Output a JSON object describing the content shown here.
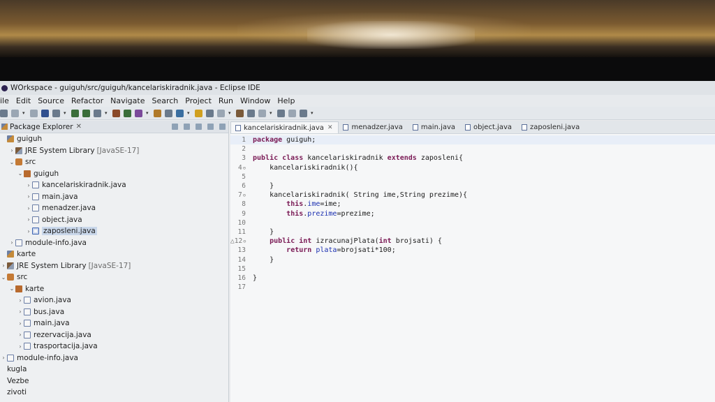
{
  "window": {
    "title": "WOrkspace - guiguh/src/guiguh/kancelariskiradnik.java - Eclipse IDE"
  },
  "menu": [
    "ile",
    "Edit",
    "Source",
    "Refactor",
    "Navigate",
    "Search",
    "Project",
    "Run",
    "Window",
    "Help"
  ],
  "explorer": {
    "title": "Package Explorer",
    "tree": [
      {
        "label": "guiguh",
        "icon": "project-icon",
        "depth": 0,
        "twisty": ""
      },
      {
        "label": "JRE System Library",
        "hint": "[JavaSE-17]",
        "icon": "library-icon",
        "depth": 1,
        "twisty": ">"
      },
      {
        "label": "src",
        "icon": "source-folder-icon",
        "depth": 1,
        "twisty": "v"
      },
      {
        "label": "guiguh",
        "icon": "package-icon",
        "depth": 2,
        "twisty": "v"
      },
      {
        "label": "kancelariskiradnik.java",
        "icon": "java-file-icon",
        "depth": 3,
        "twisty": ">"
      },
      {
        "label": "main.java",
        "icon": "java-file-icon",
        "depth": 3,
        "twisty": ">"
      },
      {
        "label": "menadzer.java",
        "icon": "java-file-icon",
        "depth": 3,
        "twisty": ">"
      },
      {
        "label": "object.java",
        "icon": "java-file-icon",
        "depth": 3,
        "twisty": ">"
      },
      {
        "label": "zaposleni.java",
        "icon": "java-file-icon",
        "depth": 3,
        "twisty": ">",
        "selected": true
      },
      {
        "label": "module-info.java",
        "icon": "java-file-icon",
        "depth": 1,
        "twisty": ">"
      },
      {
        "label": "karte",
        "icon": "project-icon",
        "depth": 0,
        "twisty": ""
      },
      {
        "label": "JRE System Library",
        "hint": "[JavaSE-17]",
        "icon": "library-icon",
        "depth": 0,
        "twisty": ">"
      },
      {
        "label": "src",
        "icon": "source-folder-icon",
        "depth": 0,
        "twisty": "v"
      },
      {
        "label": "karte",
        "icon": "package-icon",
        "depth": 1,
        "twisty": "v"
      },
      {
        "label": "avion.java",
        "icon": "java-file-icon",
        "depth": 2,
        "twisty": ">"
      },
      {
        "label": "bus.java",
        "icon": "java-file-icon",
        "depth": 2,
        "twisty": ">"
      },
      {
        "label": "main.java",
        "icon": "java-file-icon",
        "depth": 2,
        "twisty": ">"
      },
      {
        "label": "rezervacija.java",
        "icon": "java-file-icon",
        "depth": 2,
        "twisty": ">"
      },
      {
        "label": "trasportacija.java",
        "icon": "java-file-icon",
        "depth": 2,
        "twisty": ">"
      },
      {
        "label": "module-info.java",
        "icon": "java-file-icon",
        "depth": 0,
        "twisty": ">"
      },
      {
        "label": "kugla",
        "icon": "",
        "depth": 0,
        "twisty": ""
      },
      {
        "label": "Vezbe",
        "icon": "",
        "depth": 0,
        "twisty": ""
      },
      {
        "label": "zivoti",
        "icon": "",
        "depth": 0,
        "twisty": ""
      }
    ]
  },
  "editor": {
    "tabs": [
      {
        "label": "kancelariskiradnik.java",
        "active": true
      },
      {
        "label": "menadzer.java"
      },
      {
        "label": "main.java"
      },
      {
        "label": "object.java"
      },
      {
        "label": "zaposleni.java"
      }
    ],
    "lines": [
      {
        "n": "1",
        "tokens": [
          [
            "kw",
            "package"
          ],
          [
            "txt",
            " guiguh;"
          ]
        ],
        "current": true
      },
      {
        "n": "2",
        "tokens": []
      },
      {
        "n": "3",
        "tokens": [
          [
            "kw",
            "public class"
          ],
          [
            "txt",
            " kancelariskiradnik "
          ],
          [
            "kw",
            "extends"
          ],
          [
            "txt",
            " zaposleni{"
          ]
        ]
      },
      {
        "n": "4",
        "fold": "⊖",
        "tokens": [
          [
            "txt",
            "    kancelariskiradnik(){"
          ]
        ]
      },
      {
        "n": "5",
        "tokens": []
      },
      {
        "n": "6",
        "tokens": [
          [
            "txt",
            "    }"
          ]
        ]
      },
      {
        "n": "7",
        "fold": "⊖",
        "tokens": [
          [
            "txt",
            "    kancelariskiradnik( String ime,String prezime){"
          ]
        ]
      },
      {
        "n": "8",
        "tokens": [
          [
            "txt",
            "        "
          ],
          [
            "kw",
            "this"
          ],
          [
            "txt",
            "."
          ],
          [
            "fld",
            "ime"
          ],
          [
            "txt",
            "=ime;"
          ]
        ]
      },
      {
        "n": "9",
        "tokens": [
          [
            "txt",
            "        "
          ],
          [
            "kw",
            "this"
          ],
          [
            "txt",
            "."
          ],
          [
            "fld",
            "prezime"
          ],
          [
            "txt",
            "=prezime;"
          ]
        ]
      },
      {
        "n": "10",
        "tokens": []
      },
      {
        "n": "11",
        "tokens": [
          [
            "txt",
            "    }"
          ]
        ]
      },
      {
        "n": "12",
        "fold": "⊖",
        "marker": "△",
        "tokens": [
          [
            "txt",
            "    "
          ],
          [
            "kw",
            "public int"
          ],
          [
            "txt",
            " izracunajPlata("
          ],
          [
            "kw",
            "int"
          ],
          [
            "txt",
            " brojsati) {"
          ]
        ]
      },
      {
        "n": "13",
        "tokens": [
          [
            "txt",
            "        "
          ],
          [
            "kw",
            "return"
          ],
          [
            "txt",
            " "
          ],
          [
            "fld",
            "plata"
          ],
          [
            "txt",
            "=brojsati*100;"
          ]
        ]
      },
      {
        "n": "14",
        "tokens": [
          [
            "txt",
            "    }"
          ]
        ]
      },
      {
        "n": "15",
        "tokens": []
      },
      {
        "n": "16",
        "tokens": [
          [
            "txt",
            "}"
          ]
        ]
      },
      {
        "n": "17",
        "tokens": []
      }
    ]
  }
}
